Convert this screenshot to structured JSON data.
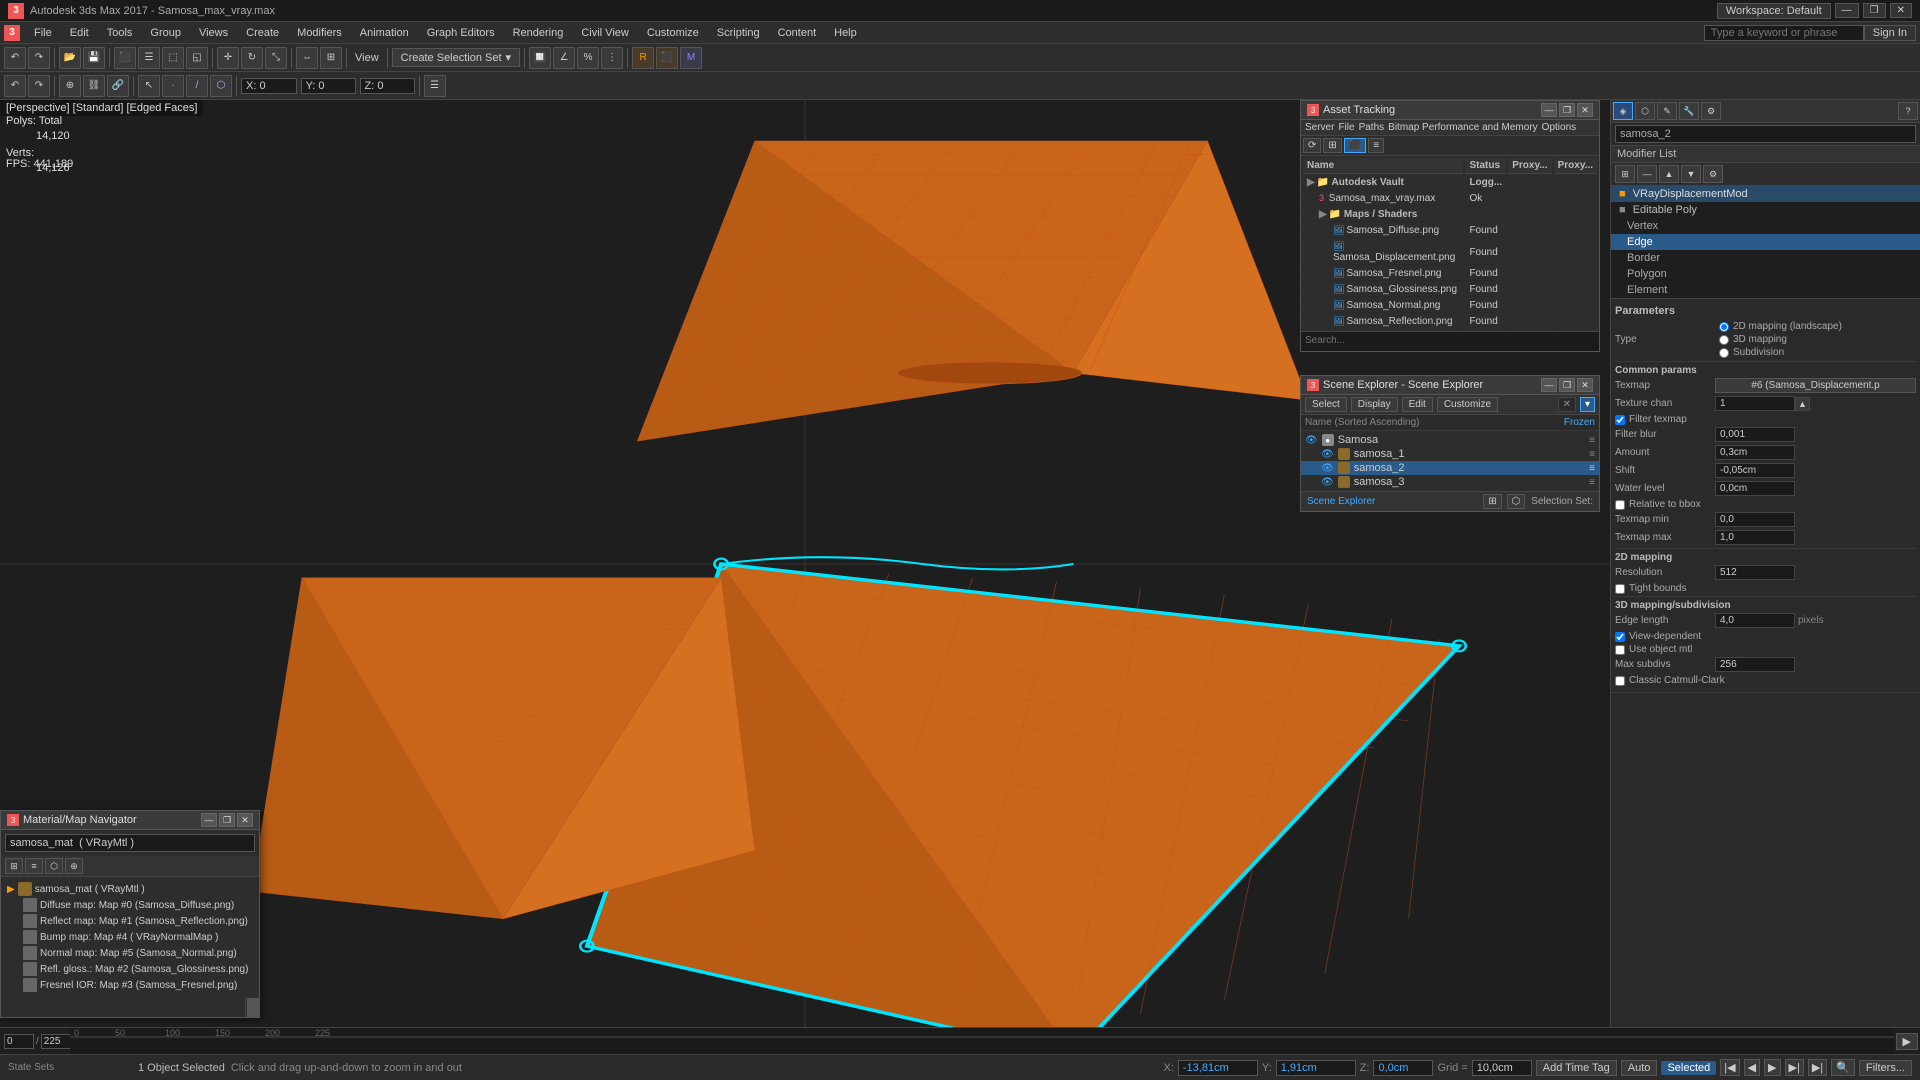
{
  "titlebar": {
    "title": "Autodesk 3ds Max 2017 - Samosa_max_vray.max",
    "workspace": "Workspace: Default",
    "minimize": "—",
    "restore": "❐",
    "close": "✕",
    "app_icon": "3"
  },
  "menubar": {
    "items": [
      "File",
      "Edit",
      "Tools",
      "Group",
      "Views",
      "Create",
      "Modifiers",
      "Animation",
      "Graph Editors",
      "Rendering",
      "Civil View",
      "Customize",
      "Scripting",
      "Content",
      "Help"
    ],
    "search_placeholder": "Type a keyword or phrase",
    "signin": "Sign In"
  },
  "viewport": {
    "label": "[Perspective] [Standard] [Edged Faces]",
    "polys_label": "Polys:",
    "polys_total": "Total",
    "polys_value": "14,120",
    "verts_label": "Verts:",
    "verts_value": "14,126",
    "fps_label": "FPS:",
    "fps_value": "441,189"
  },
  "toolbar": {
    "create_selection": "Create Selection Set",
    "dropdown_arrow": "▾"
  },
  "asset_panel": {
    "title": "Asset Tracking",
    "server_menu": "Server",
    "file_menu": "File",
    "paths_menu": "Paths",
    "bitmap_menu": "Bitmap Performance and Memory",
    "options_menu": "Options",
    "cols": [
      "Name",
      "Status",
      "Proxy...",
      "Proxy..."
    ],
    "rows": [
      {
        "type": "folder",
        "indent": 0,
        "name": "Autodesk Vault",
        "status": "Logg...",
        "proxy1": "",
        "proxy2": ""
      },
      {
        "type": "file",
        "indent": 1,
        "name": "Samosa_max_vray.max",
        "status": "Ok",
        "proxy1": "",
        "proxy2": "",
        "icon": "3"
      },
      {
        "type": "folder",
        "indent": 1,
        "name": "Maps / Shaders",
        "status": "",
        "proxy1": "",
        "proxy2": ""
      },
      {
        "type": "file",
        "indent": 2,
        "name": "Samosa_Diffuse.png",
        "status": "Found",
        "proxy1": "",
        "proxy2": ""
      },
      {
        "type": "file",
        "indent": 2,
        "name": "Samosa_Displacement.png",
        "status": "Found",
        "proxy1": "",
        "proxy2": ""
      },
      {
        "type": "file",
        "indent": 2,
        "name": "Samosa_Fresnel.png",
        "status": "Found",
        "proxy1": "",
        "proxy2": ""
      },
      {
        "type": "file",
        "indent": 2,
        "name": "Samosa_Glossiness.png",
        "status": "Found",
        "proxy1": "",
        "proxy2": ""
      },
      {
        "type": "file",
        "indent": 2,
        "name": "Samosa_Normal.png",
        "status": "Found",
        "proxy1": "",
        "proxy2": ""
      },
      {
        "type": "file",
        "indent": 2,
        "name": "Samosa_Reflection.png",
        "status": "Found",
        "proxy1": "",
        "proxy2": ""
      }
    ]
  },
  "scene_panel": {
    "title": "Scene Explorer - Scene Explorer",
    "select": "Select",
    "display": "Display",
    "edit": "Edit",
    "customize": "Customize",
    "frozen_label": "Frozen",
    "sort_label": "Name (Sorted Ascending)",
    "objects": [
      {
        "name": "Samosa",
        "level": 0,
        "selected": false
      },
      {
        "name": "samosa_1",
        "level": 1,
        "selected": false
      },
      {
        "name": "samosa_2",
        "level": 1,
        "selected": true
      },
      {
        "name": "samosa_3",
        "level": 1,
        "selected": false
      }
    ],
    "footer_label": "Scene Explorer",
    "selection_set_label": "Selection Set:"
  },
  "material_panel": {
    "title": "Material/Map Navigator",
    "field_value": "samosa_mat  ( VRayMtl )",
    "root_item": "samosa_mat ( VRayMtl )",
    "sub_items": [
      "Diffuse map: Map #0 (Samosa_Diffuse.png)",
      "Reflect map: Map #1 (Samosa_Reflection.png)",
      "Bump map: Map #4 ( VRayNormalMap )",
      "Normal map: Map #5 (Samosa_Normal.png)",
      "Refl. gloss.: Map #2 (Samosa_Glossiness.png)",
      "Fresnel IOR: Map #3 (Samosa_Fresnel.png)"
    ]
  },
  "modifier": {
    "object_name": "samosa_2",
    "list_title": "Modifier List",
    "modifiers": [
      {
        "name": "VRayDisplacementMod",
        "active": true
      },
      {
        "name": "Editable Poly",
        "active": false
      }
    ],
    "sub_levels": [
      "Vertex",
      "Edge",
      "Border",
      "Polygon",
      "Element"
    ],
    "selected_sub": "Edge",
    "params_title": "Parameters",
    "type_label": "Type",
    "type_options": [
      "2D mapping (landscape)",
      "3D mapping",
      "Subdivision"
    ],
    "selected_type": "2D mapping (landscape)",
    "common_params": "Common params",
    "texmap_label": "Texmap",
    "texmap_value": "#6 (Samosa_Displacement.p",
    "texture_chan_label": "Texture chan",
    "texture_chan_value": "1",
    "filter_texmap": "Filter texmap",
    "filter_blur_label": "Filter blur",
    "filter_blur_value": "0,001",
    "amount_label": "Amount",
    "amount_value": "0,3cm",
    "shift_label": "Shift",
    "shift_value": "-0,05cm",
    "water_level_label": "Water level",
    "water_level_value": "0,0cm",
    "relative_to_bbox": "Relative to bbox",
    "texmap_min_label": "Texmap min",
    "texmap_min_value": "0,0",
    "texmap_max_label": "Texmap max",
    "texmap_max_value": "1,0",
    "mapping_2d_label": "2D mapping",
    "resolution_label": "Resolution",
    "resolution_value": "512",
    "tight_bounds": "Tight bounds",
    "mapping_3d_label": "3D mapping/subdivision",
    "edge_length_label": "Edge length",
    "edge_length_value": "4,0",
    "pixels_label": "pixels",
    "view_dependent": "View-dependent",
    "use_object_mtl": "Use object mtl",
    "max_subdivs_label": "Max subdivs",
    "max_subdivs_value": "256",
    "classic_catmull_label": "Classic Catmull-Clark"
  },
  "statusbar": {
    "object_selected": "1 Object Selected",
    "hint": "Click and drag up-and-down to zoom in and out",
    "x_label": "X:",
    "x_value": "-13,81cm",
    "y_label": "Y:",
    "y_value": "1,91cm",
    "z_label": "Z:",
    "z_value": "0,0cm",
    "grid_label": "Grid =",
    "grid_value": "10,0cm",
    "add_time_tag": "Add Time Tag",
    "auto": "Auto",
    "selected_badge": "Selected",
    "filters_btn": "Filters..."
  },
  "timeline": {
    "current_frame": "0",
    "total_frames": "225",
    "start": "0",
    "end": "225"
  }
}
